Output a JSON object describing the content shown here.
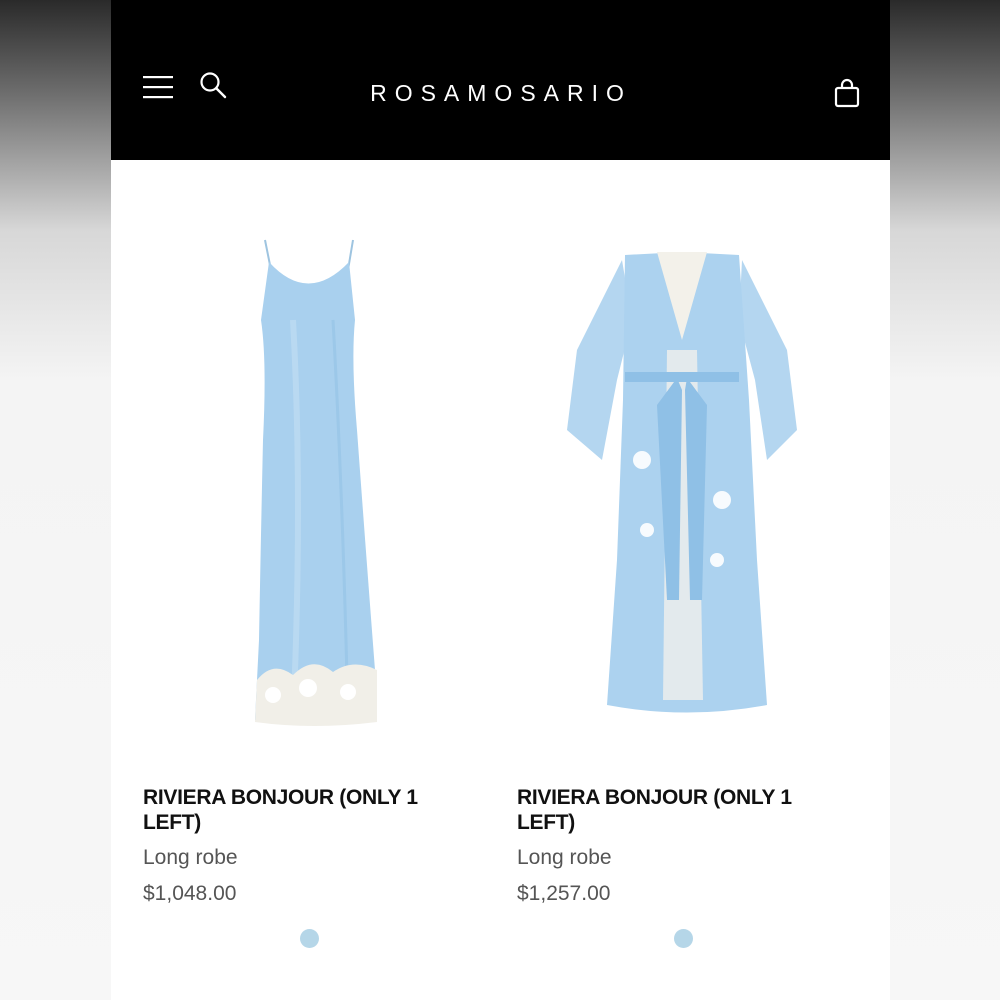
{
  "header": {
    "brand": "ROSAMOSARIO",
    "icons": [
      "menu-icon",
      "search-icon",
      "shopping-bag-icon"
    ],
    "background_color": "#000000"
  },
  "products": [
    {
      "title": "RIVIERA BONJOUR (ONLY 1 LEFT)",
      "subtitle": "Long robe",
      "price": "$1,048.00",
      "image": "light blue silk slip dress with white lace hem",
      "swatch_color": "#b5d6e8"
    },
    {
      "title": "RIVIERA BONJOUR (ONLY 1 LEFT)",
      "subtitle": "Long robe",
      "price": "$1,257.00",
      "image": "light blue sheer long robe with white lace trim and belt",
      "swatch_color": "#b5d6e8"
    }
  ]
}
